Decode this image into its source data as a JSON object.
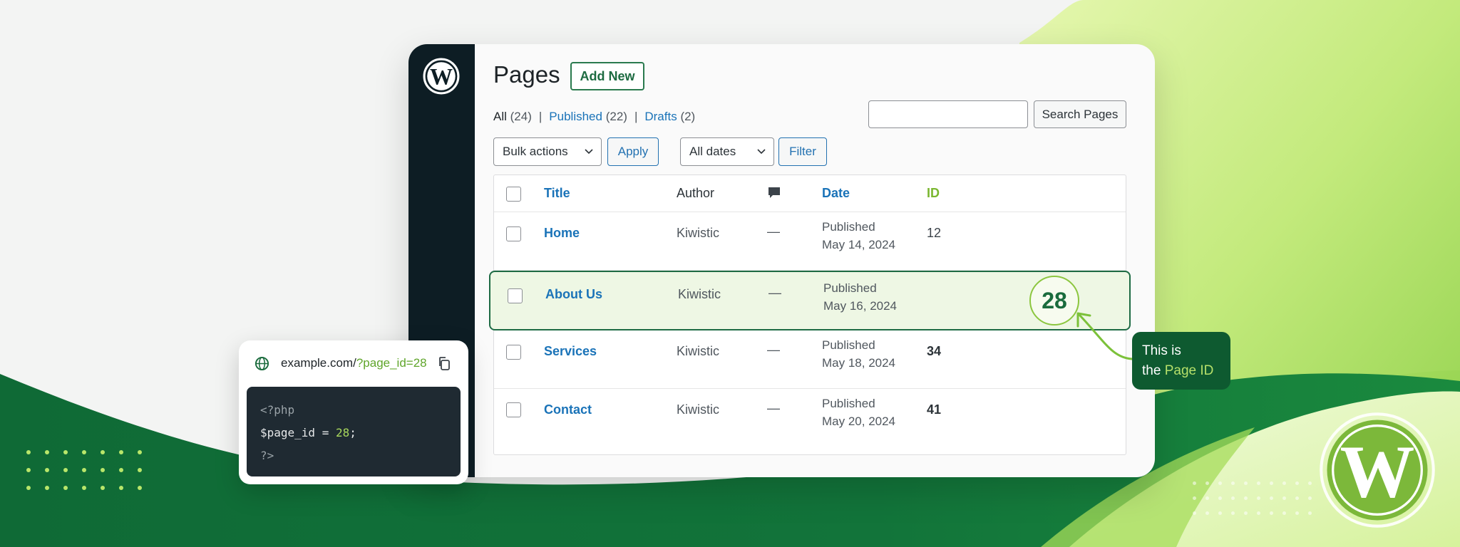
{
  "page": {
    "title": "Pages",
    "add_new": "Add New"
  },
  "status_links": {
    "all_label": "All",
    "all_count": "(24)",
    "published_label": "Published",
    "published_count": "(22)",
    "drafts_label": "Drafts",
    "drafts_count": "(2)",
    "separator": "|"
  },
  "search": {
    "placeholder": "",
    "button": "Search Pages"
  },
  "filters": {
    "bulk_actions": "Bulk actions",
    "apply": "Apply",
    "all_dates": "All dates",
    "filter": "Filter"
  },
  "table": {
    "headers": {
      "title": "Title",
      "author": "Author",
      "comments_icon": "comment-icon",
      "date": "Date",
      "id": "ID"
    },
    "rows": [
      {
        "title": "Home",
        "author": "Kiwistic",
        "comments": "—",
        "status": "Published",
        "date": "May 14, 2024",
        "id": "12"
      },
      {
        "title": "About Us",
        "author": "Kiwistic",
        "comments": "—",
        "status": "Published",
        "date": "May 16, 2024",
        "id": "28"
      },
      {
        "title": "Services",
        "author": "Kiwistic",
        "comments": "—",
        "status": "Published",
        "date": "May 18, 2024",
        "id": "34"
      },
      {
        "title": "Contact",
        "author": "Kiwistic",
        "comments": "—",
        "status": "Published",
        "date": "May 20, 2024",
        "id": "41"
      }
    ]
  },
  "callout": {
    "line1": "This is",
    "line2_prefix": "the",
    "line2_accent": "Page ID"
  },
  "url_card": {
    "url_base": "example.com/",
    "url_query": "?page_id=28",
    "code_line1": "<?php",
    "code_var": "$page_id =",
    "code_value": "28",
    "code_semicolon": ";",
    "code_line3": "?>"
  },
  "colors": {
    "brand_green": "#0e5a30",
    "accent_lime": "#8cc63f",
    "link_blue": "#1a73b8",
    "admin_bar": "#0d1d24"
  }
}
